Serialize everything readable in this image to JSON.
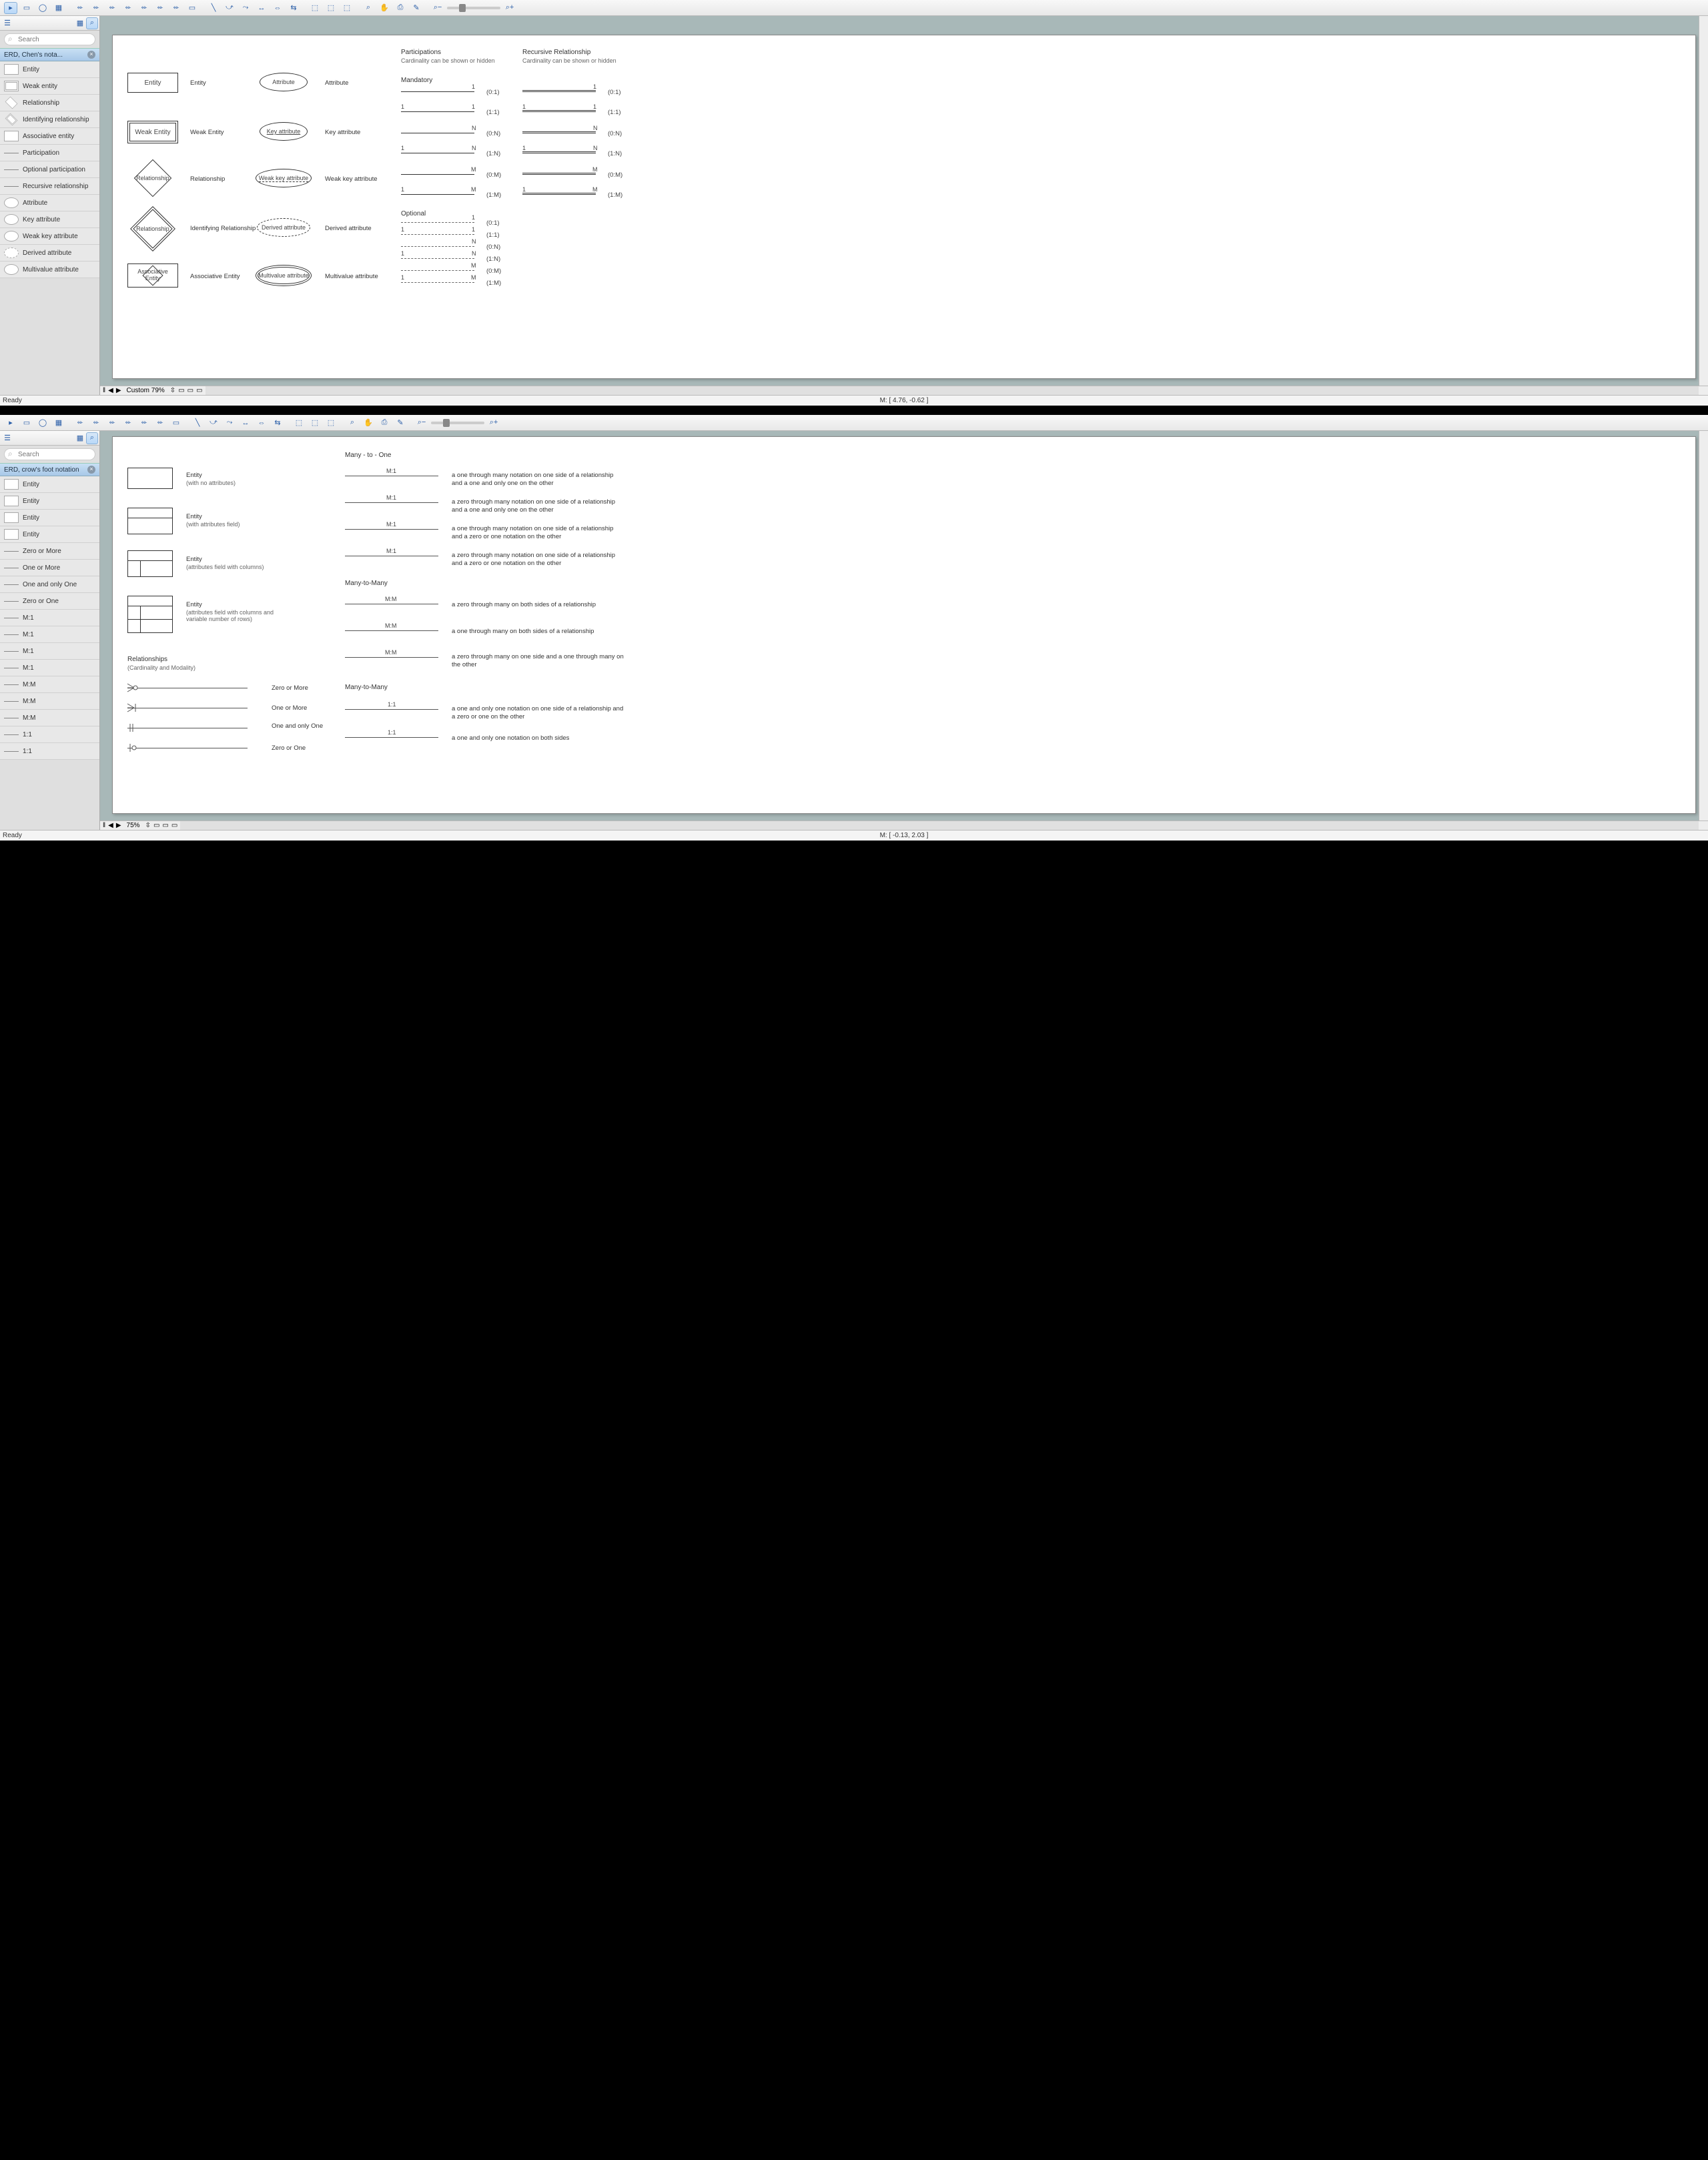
{
  "toolbar": {
    "zoom_minus": "−",
    "zoom_plus": "+"
  },
  "sidebar": {
    "search_placeholder": "Search",
    "chen": {
      "title": "ERD, Chen's nota...",
      "items": [
        {
          "label": "Entity"
        },
        {
          "label": "Weak entity"
        },
        {
          "label": "Relationship"
        },
        {
          "label": "Identifying relationship"
        },
        {
          "label": "Associative entity"
        },
        {
          "label": "Participation"
        },
        {
          "label": "Optional participation"
        },
        {
          "label": "Recursive relationship"
        },
        {
          "label": "Attribute"
        },
        {
          "label": "Key attribute"
        },
        {
          "label": "Weak key attribute"
        },
        {
          "label": "Derived attribute"
        },
        {
          "label": "Multivalue attribute"
        }
      ]
    },
    "crow": {
      "title": "ERD, crow's foot notation",
      "items": [
        {
          "label": "Entity"
        },
        {
          "label": "Entity"
        },
        {
          "label": "Entity"
        },
        {
          "label": "Entity"
        },
        {
          "label": "Zero or More"
        },
        {
          "label": "One or More"
        },
        {
          "label": "One and only One"
        },
        {
          "label": "Zero or One"
        },
        {
          "label": "M:1"
        },
        {
          "label": "M:1"
        },
        {
          "label": "M:1"
        },
        {
          "label": "M:1"
        },
        {
          "label": "M:M"
        },
        {
          "label": "M:M"
        },
        {
          "label": "M:M"
        },
        {
          "label": "1:1"
        },
        {
          "label": "1:1"
        }
      ]
    }
  },
  "page_chen": {
    "shapes": {
      "entity": "Entity",
      "weak_entity": "Weak Entity",
      "relationship": "Relationship",
      "identifying_relationship": "Relationship",
      "associative_entity": "Associative\nEntity",
      "attribute": "Attribute",
      "key_attribute": "Key attribute",
      "weak_key_attribute": "Weak key attribute",
      "derived_attribute": "Derived attribute",
      "multivalue_attribute": "Multivalue attribute"
    },
    "labels": {
      "entity": "Entity",
      "weak_entity": "Weak Entity",
      "relationship": "Relationship",
      "identifying_relationship": "Identifying Relationship",
      "associative_entity": "Associative Entity",
      "attribute": "Attribute",
      "key_attribute": "Key attribute",
      "weak_key_attribute": "Weak key attribute",
      "derived_attribute": "Derived attribute",
      "multivalue_attribute": "Multivalue attribute"
    },
    "headings": {
      "participations": "Participations",
      "participations_sub": "Cardinality can be shown or hidden",
      "recursive": "Recursive Relationship",
      "recursive_sub": "Cardinality can be shown or hidden",
      "mandatory": "Mandatory",
      "optional": "Optional"
    },
    "ratios": {
      "r01": "(0:1)",
      "r11": "(1:1)",
      "r0n": "(0:N)",
      "r1n": "(1:N)",
      "r0m": "(0:M)",
      "r1m": "(1:M)"
    },
    "card_nums": {
      "one": "1",
      "n": "N",
      "m": "M"
    }
  },
  "page_crow": {
    "entities": {
      "e1_title": "Entity",
      "e1_sub": "(with no attributes)",
      "e2_title": "Entity",
      "e2_sub": "(with attributes field)",
      "e3_title": "Entity",
      "e3_sub": "(attributes field with columns)",
      "e4_title": "Entity",
      "e4_sub": "(attributes field with columns and variable number of rows)"
    },
    "rel_heading": "Relationships",
    "rel_sub": "(Cardinality and Modality)",
    "rel_rows": {
      "zero_more": "Zero or More",
      "one_more": "One or More",
      "one_only": "One and only One",
      "zero_one": "Zero or One"
    },
    "sections": {
      "m1": "Many - to - One",
      "mm": "Many-to-Many",
      "mm2": "Many-to-Many"
    },
    "lines": {
      "m1": "M:1",
      "mm": "M:M",
      "oo": "1:1"
    },
    "descs": {
      "m1a": "a one through many notation on one side of a relationship and a one and only one on the other",
      "m1b": "a zero through many notation on one side of a relationship and a one and only one on the other",
      "m1c": "a one through many notation on one side of a relationship and a zero or one notation on the other",
      "m1d": "a zero through many notation on one side of a relationship and a zero or one notation on the other",
      "mma": "a zero through many on both sides of a relationship",
      "mmb": "a one through many on both sides of a relationship",
      "mmc": "a zero through many on one side and a one through many on the other",
      "ooa": "a one and only one notation on one side of a relationship and a zero or one on the other",
      "oob": "a one and only one notation on both sides"
    }
  },
  "bottom": {
    "custom_zoom1": "Custom 79%",
    "zoom2": "75%",
    "mouse1": "M: [ 4.76, -0.62 ]",
    "mouse2": "M: [ -0.13, 2.03 ]",
    "ready": "Ready"
  }
}
